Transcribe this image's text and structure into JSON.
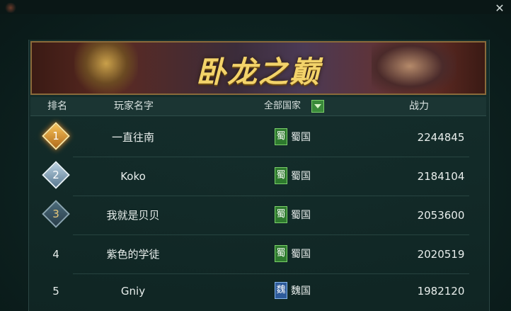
{
  "window": {
    "close_glyph": "✕"
  },
  "banner": {
    "title": "卧龙之巅"
  },
  "table": {
    "headers": {
      "rank": "排名",
      "name": "玩家名字",
      "country": "全部国家",
      "power": "战力"
    },
    "rows": [
      {
        "rank": "1",
        "name": "一直往南",
        "flag": "蜀",
        "country": "蜀国",
        "power": "2244845"
      },
      {
        "rank": "2",
        "name": "Koko",
        "flag": "蜀",
        "country": "蜀国",
        "power": "2184104"
      },
      {
        "rank": "3",
        "name": "我就是贝贝",
        "flag": "蜀",
        "country": "蜀国",
        "power": "2053600"
      },
      {
        "rank": "4",
        "name": "紫色的学徒",
        "flag": "蜀",
        "country": "蜀国",
        "power": "2020519"
      },
      {
        "rank": "5",
        "name": "Gniy",
        "flag": "魏",
        "country": "魏国",
        "power": "1982120"
      }
    ]
  },
  "colors": {
    "gold": "#f3d36a",
    "shu": "#2e7a2e",
    "wei": "#2d5a9a"
  }
}
